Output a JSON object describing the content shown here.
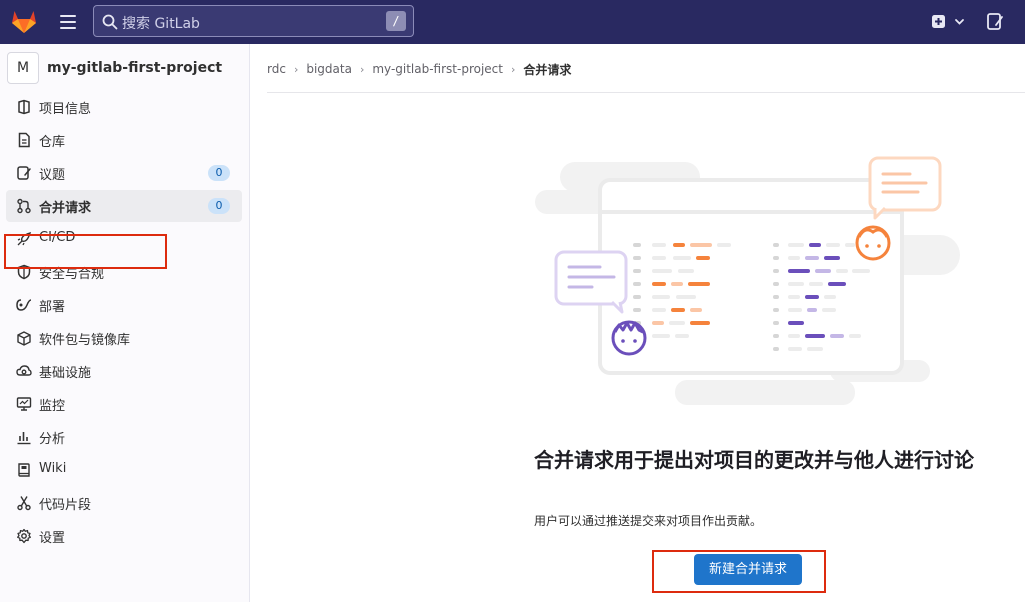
{
  "topbar": {
    "search_placeholder": "搜索 GitLab",
    "search_shortcut": "/",
    "icons": [
      "gitlab-logo",
      "hamburger-menu-icon",
      "search-icon",
      "plus-icon",
      "chevron-down-icon",
      "todo-icon"
    ]
  },
  "sidebar": {
    "project_avatar": "M",
    "project_name": "my-gitlab-first-project",
    "items": [
      {
        "label": "项目信息",
        "icon": "project-info-icon"
      },
      {
        "label": "仓库",
        "icon": "repository-icon"
      },
      {
        "label": "议题",
        "icon": "issues-icon",
        "count": "0"
      },
      {
        "label": "合并请求",
        "icon": "merge-request-icon",
        "count": "0",
        "active": true
      },
      {
        "label": "CI/CD",
        "icon": "rocket-icon"
      },
      {
        "label": "安全与合规",
        "icon": "shield-icon"
      },
      {
        "label": "部署",
        "icon": "deployments-icon"
      },
      {
        "label": "软件包与镜像库",
        "icon": "package-icon"
      },
      {
        "label": "基础设施",
        "icon": "cloud-gear-icon"
      },
      {
        "label": "监控",
        "icon": "monitor-icon"
      },
      {
        "label": "分析",
        "icon": "chart-icon"
      },
      {
        "label": "Wiki",
        "icon": "book-icon"
      },
      {
        "label": "代码片段",
        "icon": "scissors-icon"
      },
      {
        "label": "设置",
        "icon": "gear-icon"
      }
    ]
  },
  "breadcrumb": {
    "items": [
      "rdc",
      "bigdata",
      "my-gitlab-first-project"
    ],
    "current": "合并请求",
    "separator": "›"
  },
  "empty_state": {
    "title": "合并请求用于提出对项目的更改并与他人进行讨论",
    "description": "用户可以通过推送提交来对项目作出贡献。",
    "button": "新建合并请求"
  },
  "colors": {
    "topbar_bg": "#292961",
    "accent_orange": "#f5833c",
    "accent_purple": "#6b4fbb",
    "primary_button": "#1f75cb",
    "highlight_box": "#dd2b0e",
    "badge_bg": "#cbe2f9"
  }
}
